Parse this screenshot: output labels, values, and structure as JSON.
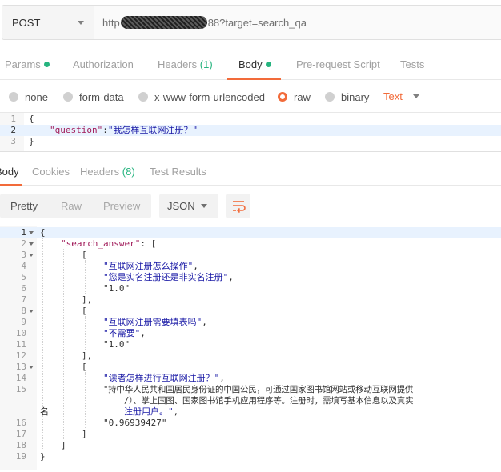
{
  "request": {
    "method": "POST",
    "url_prefix": "http",
    "url_suffix": "88?target=search_qa"
  },
  "request_tabs": {
    "params": "Params",
    "authorization": "Authorization",
    "headers": "Headers",
    "headers_count": "(1)",
    "body": "Body",
    "prerequest": "Pre-request Script",
    "tests": "Tests"
  },
  "body_types": {
    "none": "none",
    "form_data": "form-data",
    "urlencoded": "x-www-form-urlencoded",
    "raw": "raw",
    "binary": "binary",
    "text": "Text",
    "selected": "raw"
  },
  "request_body": {
    "line_numbers": [
      "1",
      "2",
      "3"
    ],
    "open": "{",
    "key": "\"question\"",
    "colon": ":",
    "value": "\"我怎样互联网注册？\"",
    "close": "}"
  },
  "response_tabs": {
    "body": "Body",
    "cookies": "Cookies",
    "headers": "Headers",
    "headers_count": "(8)",
    "test_results": "Test Results"
  },
  "response_toolbar": {
    "pretty": "Pretty",
    "raw": "Raw",
    "preview": "Preview",
    "format": "JSON"
  },
  "response_body": {
    "lines": [
      {
        "n": "1",
        "text": "{"
      },
      {
        "n": "2",
        "key": "\"search_answer\"",
        "text": ": ["
      },
      {
        "n": "3",
        "text": "["
      },
      {
        "n": "4",
        "str": "\"互联网注册怎么操作\"",
        "text": ","
      },
      {
        "n": "5",
        "str": "\"您是实名注册还是非实名注册\"",
        "text": ","
      },
      {
        "n": "6",
        "num": "\"1.0\""
      },
      {
        "n": "7",
        "text": "],"
      },
      {
        "n": "8",
        "text": "["
      },
      {
        "n": "9",
        "str": "\"互联网注册需要填表吗\"",
        "text": ","
      },
      {
        "n": "10",
        "str": "\"不需要\"",
        "text": ","
      },
      {
        "n": "11",
        "num": "\"1.0\""
      },
      {
        "n": "12",
        "text": "],"
      },
      {
        "n": "13",
        "text": "["
      },
      {
        "n": "14",
        "str": "\"读者怎样进行互联网注册？\"",
        "text": ","
      },
      {
        "n": "15",
        "str": "\"持中华人民共和国居民身份证的中国公民，可通过国家图书馆网站或移动互联网提供",
        "str2": "/）、掌上国图、国家图书馆手机应用程序等。注册时，需填写基本信息以及真实",
        "wrap_a": "名",
        "str3": "注册用户。\"",
        "text": ","
      },
      {
        "n": "16",
        "num": "\"0.96939427\""
      },
      {
        "n": "17",
        "text": "]"
      },
      {
        "n": "18",
        "text": "]"
      },
      {
        "n": "19",
        "text": "}"
      }
    ]
  },
  "colors": {
    "accent": "#f26b3a",
    "green": "#26b47f",
    "string": "#1a1aa6",
    "key": "#a11b5a",
    "number": "#098658"
  }
}
